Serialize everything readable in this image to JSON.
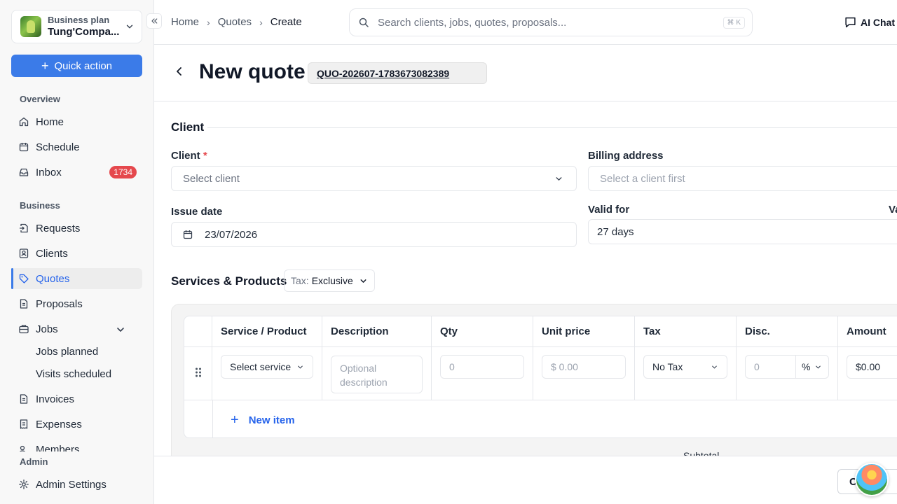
{
  "workspace": {
    "plan": "Business plan",
    "name": "Tung'Compa..."
  },
  "quick_action": {
    "label": "Quick action"
  },
  "sidebar": {
    "overview_label": "Overview",
    "business_label": "Business",
    "admin_label": "Admin",
    "items": {
      "home": "Home",
      "schedule": "Schedule",
      "inbox": "Inbox",
      "inbox_badge": "1734",
      "requests": "Requests",
      "clients": "Clients",
      "quotes": "Quotes",
      "proposals": "Proposals",
      "jobs": "Jobs",
      "jobs_planned": "Jobs planned",
      "visits_scheduled": "Visits scheduled",
      "invoices": "Invoices",
      "expenses": "Expenses",
      "members": "Members",
      "admin_settings": "Admin Settings"
    }
  },
  "topbar": {
    "breadcrumb": [
      "Home",
      "Quotes",
      "Create"
    ],
    "search_placeholder": "Search clients, jobs, quotes, proposals...",
    "shortcut": "⌘ K",
    "ai_chat": "AI Chat"
  },
  "header": {
    "title": "New quote",
    "quote_number": "QUO-202607-1783673082389"
  },
  "client_section": {
    "title": "Client",
    "client_label": "Client",
    "required_mark": "*",
    "client_placeholder": "Select client",
    "billing_label": "Billing address",
    "billing_placeholder": "Select a client first",
    "issue_date_label": "Issue date",
    "issue_date": "23/07/2026",
    "valid_for_label": "Valid for",
    "valid_for": "27 days",
    "valid_until_label": "Va"
  },
  "services": {
    "title": "Services & Products",
    "tax_prefix": "Tax:",
    "tax_mode": "Exclusive",
    "columns": [
      "Service / Product",
      "Description",
      "Qty",
      "Unit price",
      "Tax",
      "Disc.",
      "Amount"
    ],
    "row": {
      "service_placeholder": "Select service",
      "description_placeholder": "Optional description",
      "qty_placeholder": "0",
      "unit_price_placeholder": "$ 0.00",
      "tax": "No Tax",
      "discount_placeholder": "0",
      "discount_unit": "%",
      "amount": "$0.00"
    },
    "new_item": "New item",
    "subtotal_label": "Subtotal"
  },
  "footer": {
    "button_partial": "C"
  },
  "colors": {
    "accent": "#3b7be8",
    "badge": "#e5484d"
  }
}
